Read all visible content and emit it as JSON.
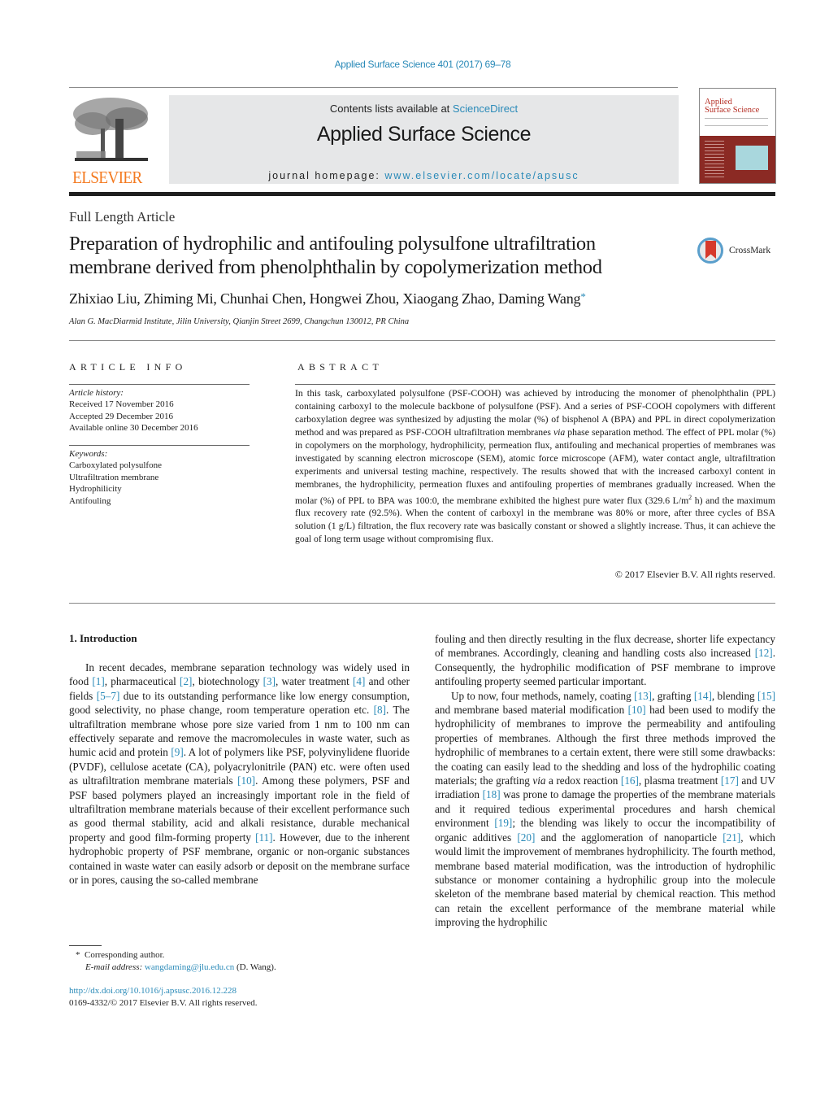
{
  "masthead": {
    "citation": "Applied Surface Science 401 (2017) 69–78",
    "contents_prefix": "Contents lists available at ",
    "contents_link": "ScienceDirect",
    "journal_title": "Applied Surface Science",
    "homepage_prefix": "journal homepage: ",
    "homepage_link": "www.elsevier.com/locate/apsusc",
    "publisher_logo_text": "ELSEVIER",
    "cover_title_line1": "Applied",
    "cover_title_line2": "Surface Science",
    "colors": {
      "link": "#2a8ab8",
      "elsevier_orange": "#f47a20",
      "cover_red": "#8b2a24",
      "banner_gray": "#e6e7e8"
    }
  },
  "article": {
    "type": "Full Length Article",
    "title_line1": "Preparation of hydrophilic and antifouling polysulfone ultrafiltration",
    "title_line2": "membrane derived from phenolphthalin by copolymerization method",
    "crossmark_label": "CrossMark",
    "authors": "Zhixiao Liu, Zhiming Mi, Chunhai Chen, Hongwei Zhou, Xiaogang Zhao, Daming Wang",
    "corresponding_mark": "*",
    "affiliation": "Alan G. MacDiarmid Institute, Jilin University, Qianjin Street 2699, Changchun 130012, PR China"
  },
  "article_info": {
    "heading": "ARTICLE INFO",
    "history_label": "Article history:",
    "received": "Received 17 November 2016",
    "accepted": "Accepted 29 December 2016",
    "online": "Available online 30 December 2016",
    "keywords_label": "Keywords:",
    "keywords": [
      "Carboxylated polysulfone",
      "Ultrafiltration membrane",
      "Hydrophilicity",
      "Antifouling"
    ]
  },
  "abstract": {
    "heading": "ABSTRACT",
    "part1": "In this task, carboxylated polysulfone (PSF-COOH) was achieved by introducing the monomer of phenolphthalin (PPL) containing carboxyl to the molecule backbone of polysulfone (PSF). And a series of PSF-COOH copolymers with different carboxylation degree was synthesized by adjusting the molar (%) of bisphenol A (BPA) and PPL in direct copolymerization method and was prepared as PSF-COOH ultrafiltration membranes ",
    "via": "via",
    "part2": " phase separation method. The effect of PPL molar (%) in copolymers on the morphology, hydrophilicity, permeation flux, antifouling and mechanical properties of membranes was investigated by scanning electron microscope (SEM), atomic force microscope (AFM), water contact angle, ultrafiltration experiments and universal testing machine, respectively. The results showed that with the increased carboxyl content in membranes, the hydrophilicity, permeation fluxes and antifouling properties of membranes gradually increased. When the molar (%) of PPL to BPA was 100:0, the membrane exhibited the highest pure water flux (329.6 L/m",
    "sup": "2",
    "part3": " h) and the maximum flux recovery rate (92.5%). When the content of carboxyl in the membrane was 80% or more, after three cycles of BSA solution (1 g/L) filtration, the flux recovery rate was basically constant or showed a slightly increase. Thus, it can achieve the goal of long term usage without compromising flux.",
    "copyright": "© 2017 Elsevier B.V. All rights reserved."
  },
  "introduction": {
    "heading": "1.  Introduction",
    "left_col": [
      {
        "t": "In recent decades, membrane separation technology was widely used in food "
      },
      {
        "r": "[1]"
      },
      {
        "t": ", pharmaceutical "
      },
      {
        "r": "[2]"
      },
      {
        "t": ", biotechnology "
      },
      {
        "r": "[3]"
      },
      {
        "t": ", water treatment "
      },
      {
        "r": "[4]"
      },
      {
        "t": " and other fields "
      },
      {
        "r": "[5–7]"
      },
      {
        "t": " due to its outstanding performance like low energy consumption, good selectivity, no phase change, room temperature operation etc. "
      },
      {
        "r": "[8]"
      },
      {
        "t": ". The ultrafiltration membrane whose pore size varied from 1 nm to 100 nm can effectively separate and remove the macromolecules in waste water, such as humic acid and protein "
      },
      {
        "r": "[9]"
      },
      {
        "t": ". A lot of polymers like PSF, polyvinylidene fluoride (PVDF), cellulose acetate (CA), polyacrylonitrile (PAN) etc. were often used as ultrafiltration membrane materials "
      },
      {
        "r": "[10]"
      },
      {
        "t": ". Among these polymers, PSF and PSF based polymers played an increasingly important role in the field of ultrafiltration membrane materials because of their excellent performance such as good thermal stability, acid and alkali resistance, durable mechanical property and good film-forming property "
      },
      {
        "r": "[11]"
      },
      {
        "t": ". However, due to the inherent hydrophobic property of PSF membrane, organic or non-organic substances contained in waste water can easily adsorb or deposit on the membrane surface or in pores, causing the so-called membrane"
      }
    ],
    "right_col_p1": [
      {
        "t": "fouling and then directly resulting in the flux decrease, shorter life expectancy of membranes. Accordingly, cleaning and handling costs also increased "
      },
      {
        "r": "[12]"
      },
      {
        "t": ". Consequently, the hydrophilic modification of PSF membrane to improve antifouling property seemed particular important."
      }
    ],
    "right_col_p2": [
      {
        "t": "Up to now, four methods, namely, coating "
      },
      {
        "r": "[13]"
      },
      {
        "t": ", grafting "
      },
      {
        "r": "[14]"
      },
      {
        "t": ", blending "
      },
      {
        "r": "[15]"
      },
      {
        "t": " and membrane based material modification "
      },
      {
        "r": "[10]"
      },
      {
        "t": " had been used to modify the hydrophilicity of membranes to improve the permeability and antifouling properties of membranes. Although the first three methods improved the hydrophilic of membranes to a certain extent, there were still some drawbacks: the coating can easily lead to the shedding and loss of the hydrophilic coating materials; the grafting "
      },
      {
        "i": "via"
      },
      {
        "t": " a redox reaction "
      },
      {
        "r": "[16]"
      },
      {
        "t": ", plasma treatment "
      },
      {
        "r": "[17]"
      },
      {
        "t": " and UV irradiation "
      },
      {
        "r": "[18]"
      },
      {
        "t": " was prone to damage the properties of the membrane materials and it required tedious experimental procedures and harsh chemical environment "
      },
      {
        "r": "[19]"
      },
      {
        "t": "; the blending was likely to occur the incompatibility of organic additives "
      },
      {
        "r": "[20]"
      },
      {
        "t": " and the agglomeration of nanoparticle "
      },
      {
        "r": "[21]"
      },
      {
        "t": ", which would limit the improvement of membranes hydrophilicity. The fourth method, membrane based material modification, was the introduction of hydrophilic substance or monomer containing a hydrophilic group into the molecule skeleton of the membrane based material by chemical reaction. This method can retain the excellent performance of the membrane material while improving the hydrophilic"
      }
    ]
  },
  "footnotes": {
    "star": "*",
    "corresponding": "Corresponding author.",
    "email_label": "E-mail address: ",
    "email": "wangdaming@jlu.edu.cn",
    "email_suffix": " (D. Wang).",
    "doi": "http://dx.doi.org/10.1016/j.apsusc.2016.12.228",
    "issn_line": "0169-4332/© 2017 Elsevier B.V. All rights reserved."
  }
}
